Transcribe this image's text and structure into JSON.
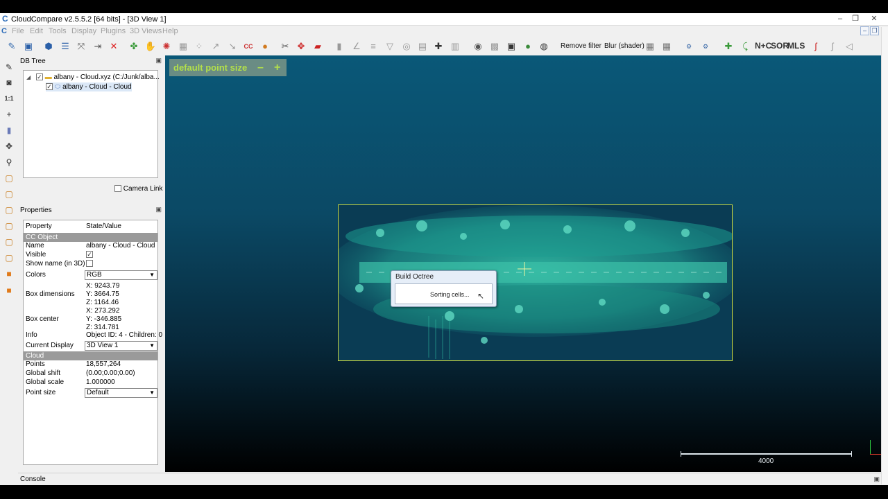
{
  "window": {
    "title": "CloudCompare v2.5.5.2 [64 bits] - [3D View 1]",
    "controls": [
      "–",
      "❐",
      "✕"
    ]
  },
  "menu": {
    "items": [
      "File",
      "Edit",
      "Tools",
      "Display",
      "Plugins",
      "3D Views",
      "Help"
    ],
    "mdi_controls": [
      "–",
      "❐",
      "✕"
    ]
  },
  "toolbar": {
    "remove_filter": "Remove filter",
    "blur_shader": "Blur (shader)",
    "nc_label": "N+C",
    "sor_label": "SOR",
    "mls_label": "MLS"
  },
  "left_tools": {
    "one_to_one": "1:1"
  },
  "db_tree": {
    "header": "DB Tree",
    "items": [
      {
        "label": "albany - Cloud.xyz (C:/Junk/alba...",
        "checked": true,
        "icon": "folder-icon",
        "expanded": true
      },
      {
        "label": "albany - Cloud - Cloud",
        "checked": true,
        "icon": "cloud-icon"
      }
    ],
    "camera_link": "Camera Link"
  },
  "properties": {
    "header": "Properties",
    "col_property": "Property",
    "col_value": "State/Value",
    "section_object": "CC Object",
    "name_key": "Name",
    "name_value": "albany - Cloud - Cloud",
    "visible_key": "Visible",
    "show_name_key": "Show name (in 3D)",
    "colors_key": "Colors",
    "colors_value": "RGB",
    "box_dim_key": "Box dimensions",
    "box_dim_x": "X: 9243.79",
    "box_dim_y": "Y: 3664.75",
    "box_dim_z": "Z: 1164.46",
    "box_center_key": "Box center",
    "box_center_x": "X: 273.292",
    "box_center_y": "Y: -346.885",
    "box_center_z": "Z: 314.781",
    "info_key": "Info",
    "info_value": "Object ID: 4 - Children: 0",
    "current_display_key": "Current Display",
    "current_display_value": "3D View 1",
    "section_cloud": "Cloud",
    "points_key": "Points",
    "points_value": "18,557,264",
    "global_shift_key": "Global shift",
    "global_shift_value": "(0.00;0.00;0.00)",
    "global_scale_key": "Global scale",
    "global_scale_value": "1.000000",
    "point_size_key": "Point size",
    "point_size_value": "Default"
  },
  "view": {
    "default_point_size": "default point size",
    "minus": "–",
    "plus": "+",
    "scale_label": "4000"
  },
  "dialog": {
    "title": "Build Octree",
    "message": "Sorting cells..."
  },
  "console": {
    "header": "Console"
  },
  "colors": {
    "accent_green": "#b3e04a",
    "bbox_yellow": "#c8d640",
    "cloud_teal": "#2bb3a0"
  }
}
